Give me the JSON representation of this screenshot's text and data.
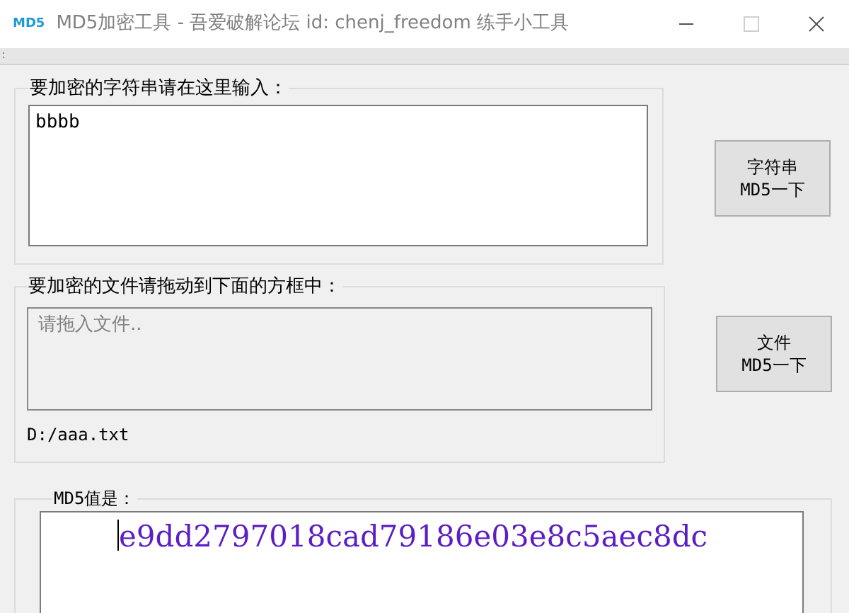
{
  "window": {
    "logo": "MD5",
    "title": "MD5加密工具 - 吾爱破解论坛 id: chenj_freedom 练手小工具",
    "maximize_disabled": true
  },
  "string_group": {
    "label": "要加密的字符串请在这里输入：",
    "value": "bbbb",
    "button": "字符串\nMD5一下"
  },
  "file_group": {
    "label": "要加密的文件请拖动到下面的方框中：",
    "placeholder": "请拖入文件..",
    "path": "D:/aaa.txt",
    "button": "文件\nMD5一下"
  },
  "result_group": {
    "label": "MD5值是：",
    "value": "e9dd2797018cad79186e03e8c5aec8dc"
  }
}
